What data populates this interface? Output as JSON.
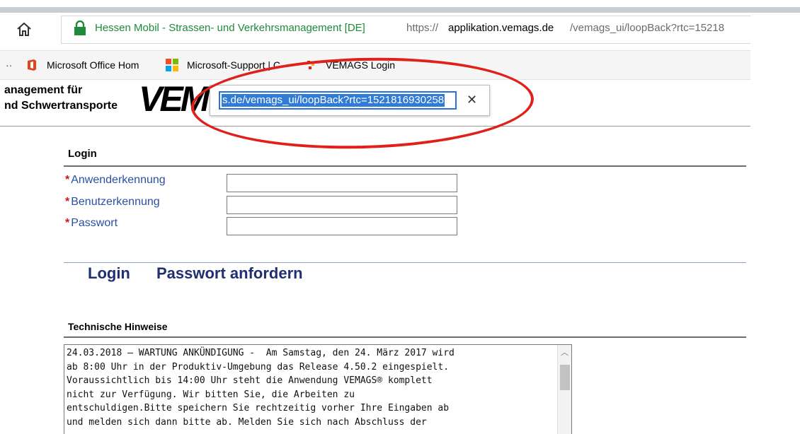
{
  "browser": {
    "home_icon": "home-icon",
    "site_identity": "Hessen Mobil - Strassen- und Verkehrsmanagement [DE]",
    "url_scheme": "https://",
    "url_host": "applikation.vemags.de",
    "url_path": "/vemags_ui/loopBack?rtc=15218",
    "favorites": {
      "prefix": "··",
      "items": [
        {
          "label": "Microsoft Office Hom",
          "icon": "office-icon"
        },
        {
          "label": "Microsoft-Support | C",
          "icon": "windows-icon"
        },
        {
          "label": "VEMAGS Login",
          "icon": "vemags-icon"
        }
      ]
    },
    "url_popup": {
      "value": "s.de/vemags_ui/loopBack?rtc=1521816930258",
      "clear_glyph": "✕"
    }
  },
  "banner": {
    "line1": "anagement für",
    "line2": "nd Schwertransporte",
    "logo_text": "VEM"
  },
  "login": {
    "title": "Login",
    "fields": [
      {
        "label": "Anwenderkennung",
        "required_mark": "*",
        "value": ""
      },
      {
        "label": "Benutzerkennung",
        "required_mark": "*",
        "value": ""
      },
      {
        "label": "Passwort",
        "required_mark": "*",
        "value": ""
      }
    ],
    "actions": {
      "login": "Login",
      "request_password": "Passwort anfordern"
    }
  },
  "notes": {
    "title": "Technische Hinweise",
    "text": "24.03.2018 – WARTUNG ANKÜNDIGUNG -  Am Samstag, den 24. März 2017 wird\nab 8:00 Uhr in der Produktiv-Umgebung das Release 4.50.2 eingespielt.\nVoraussichtlich bis 14:00 Uhr steht die Anwendung VEMAGS® komplett\nnicht zur Verfügung. Wir bitten Sie, die Arbeiten zu\nentschuldigen.Bitte speichern Sie rechtzeitig vorher Ihre Eingaben ab\nund melden sich dann bitte ab. Melden Sie sich nach Abschluss der"
  },
  "colors": {
    "site_identity": "#1f8a3b",
    "field_label": "#2750a6",
    "required": "#d0141b",
    "action_link": "#1f2f6f",
    "selection": "#2f7bd6",
    "annotation": "#e0201b"
  }
}
